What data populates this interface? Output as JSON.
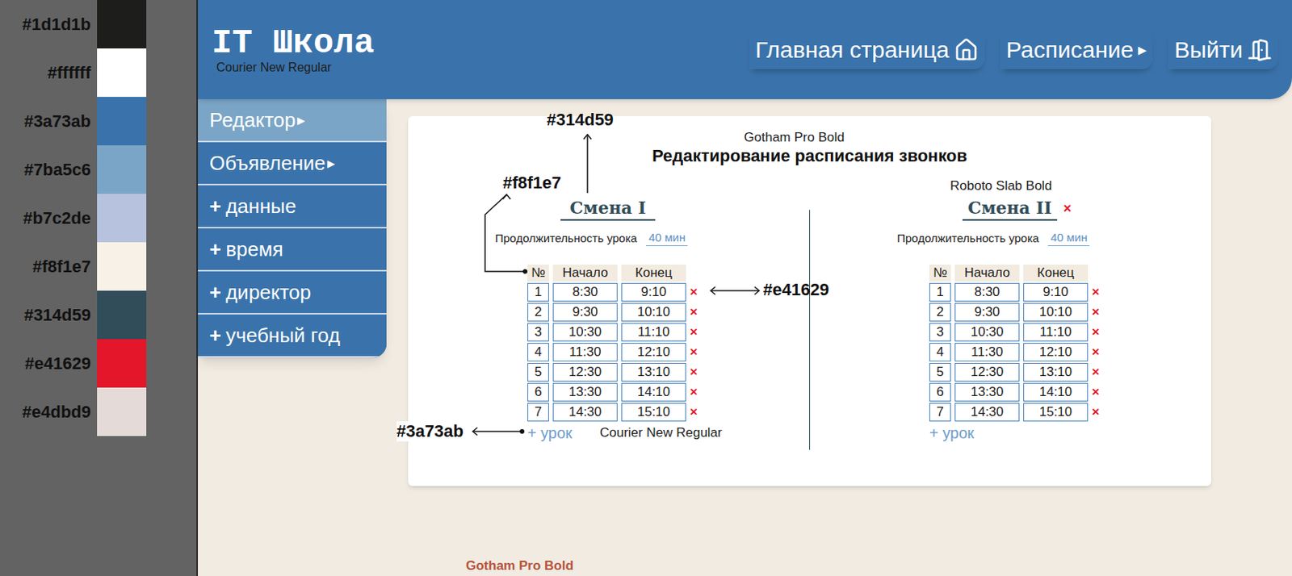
{
  "palette": [
    {
      "label": "#1d1d1b",
      "color": "#1d1d1b"
    },
    {
      "label": "#ffffff",
      "color": "#ffffff"
    },
    {
      "label": "#3a73ab",
      "color": "#3a73ab"
    },
    {
      "label": "#7ba5c6",
      "color": "#7ba5c6"
    },
    {
      "label": "#b7c2de",
      "color": "#b7c2de"
    },
    {
      "label": "#f8f1e7",
      "color": "#f8f1e7"
    },
    {
      "label": "#314d59",
      "color": "#314d59"
    },
    {
      "label": "#e41629",
      "color": "#e41629"
    },
    {
      "label": "#e4dbd9",
      "color": "#e4dbd9"
    }
  ],
  "header": {
    "logo": "IT Школа",
    "logo_note": "Courier New Regular",
    "nav": [
      {
        "label": "Главная страница",
        "kind": "home"
      },
      {
        "label": "Расписание",
        "kind": "menu",
        "glyph": "▸"
      },
      {
        "label": "Выйти",
        "kind": "exit"
      }
    ]
  },
  "sidebar": {
    "items": [
      {
        "label": "Редактор",
        "glyph": "▸",
        "kind": "menu",
        "selected": true
      },
      {
        "label": "Объявление",
        "glyph": "▸",
        "kind": "menu",
        "selected": false
      },
      {
        "prefix": "+",
        "label": "данные",
        "kind": "add",
        "selected": false
      },
      {
        "prefix": "+",
        "label": "время",
        "kind": "add",
        "selected": false
      },
      {
        "prefix": "+",
        "label": "директор",
        "kind": "add",
        "selected": false
      },
      {
        "prefix": "+",
        "label": "учебный год",
        "kind": "add",
        "selected": false
      }
    ]
  },
  "card": {
    "title_note": "Gotham Pro Bold",
    "title": "Редактирование расписания звонков",
    "shifts": [
      {
        "name": "Смена I",
        "duration_label": "Продолжительность урока",
        "duration_value": "40 мин",
        "columns": [
          "№",
          "Начало",
          "Конец"
        ],
        "rows": [
          {
            "n": "1",
            "start": "8:30",
            "end": "9:10",
            "remove": "×"
          },
          {
            "n": "2",
            "start": "9:30",
            "end": "10:10",
            "remove": "×"
          },
          {
            "n": "3",
            "start": "10:30",
            "end": "11:10",
            "remove": "×"
          },
          {
            "n": "4",
            "start": "11:30",
            "end": "12:10",
            "remove": "×"
          },
          {
            "n": "5",
            "start": "12:30",
            "end": "13:10",
            "remove": "×"
          },
          {
            "n": "6",
            "start": "13:30",
            "end": "14:10",
            "remove": "×"
          },
          {
            "n": "7",
            "start": "14:30",
            "end": "15:10",
            "remove": "×"
          }
        ],
        "add_label": "+ урок"
      },
      {
        "name": "Смена II",
        "font_note": "Roboto Slab Bold",
        "remove": "×",
        "duration_label": "Продолжительность урока",
        "duration_value": "40 мин",
        "columns": [
          "№",
          "Начало",
          "Конец"
        ],
        "rows": [
          {
            "n": "1",
            "start": "8:30",
            "end": "9:10",
            "remove": "×"
          },
          {
            "n": "2",
            "start": "9:30",
            "end": "10:10",
            "remove": "×"
          },
          {
            "n": "3",
            "start": "10:30",
            "end": "11:10",
            "remove": "×"
          },
          {
            "n": "4",
            "start": "11:30",
            "end": "12:10",
            "remove": "×"
          },
          {
            "n": "5",
            "start": "12:30",
            "end": "13:10",
            "remove": "×"
          },
          {
            "n": "6",
            "start": "13:30",
            "end": "14:10",
            "remove": "×"
          },
          {
            "n": "7",
            "start": "14:30",
            "end": "15:10",
            "remove": "×"
          }
        ],
        "add_label": "+ урок"
      }
    ]
  },
  "annotations": {
    "title_color": "#314d59",
    "header_bg": "#f8f1e7",
    "remove_color": "#e41629",
    "add_color": "#3a73ab",
    "add_font": "Courier New Regular"
  },
  "footer_note": "Gotham Pro Bold"
}
